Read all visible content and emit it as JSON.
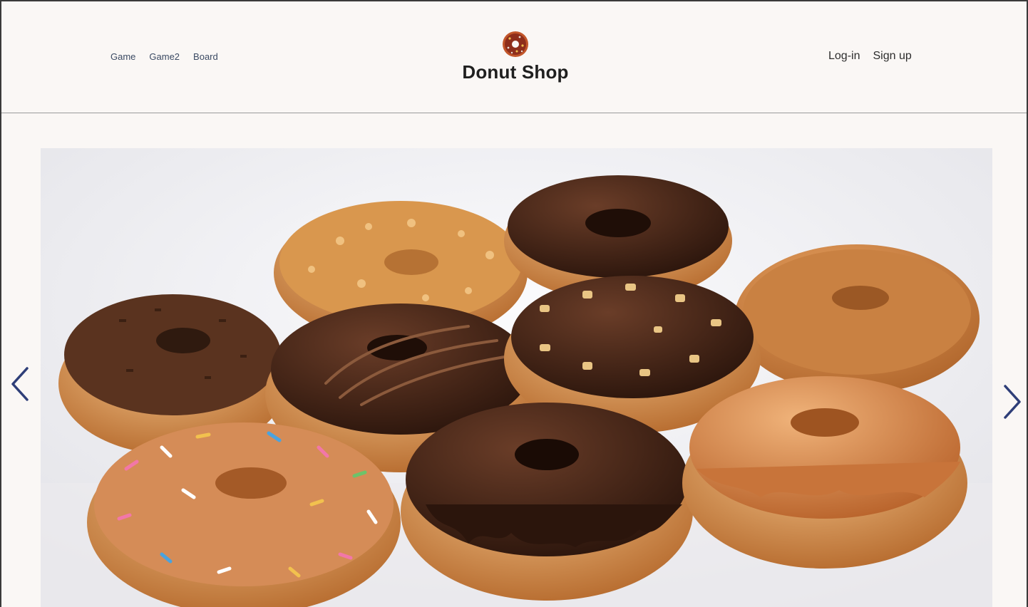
{
  "header": {
    "nav_left": [
      {
        "label": "Game"
      },
      {
        "label": "Game2"
      },
      {
        "label": "Board"
      }
    ],
    "brand": {
      "name": "Donut Shop",
      "logo_icon": "donut-icon"
    },
    "nav_right": [
      {
        "label": "Log-in"
      },
      {
        "label": "Sign up"
      }
    ]
  },
  "carousel": {
    "slide_image": "donut-assortment-photo",
    "prev_icon": "chevron-left-icon",
    "next_icon": "chevron-right-icon"
  },
  "colors": {
    "background": "#faf7f5",
    "nav_link": "#3b4a63",
    "brand_text": "#1f1f1f",
    "arrow": "#2e3e78"
  }
}
